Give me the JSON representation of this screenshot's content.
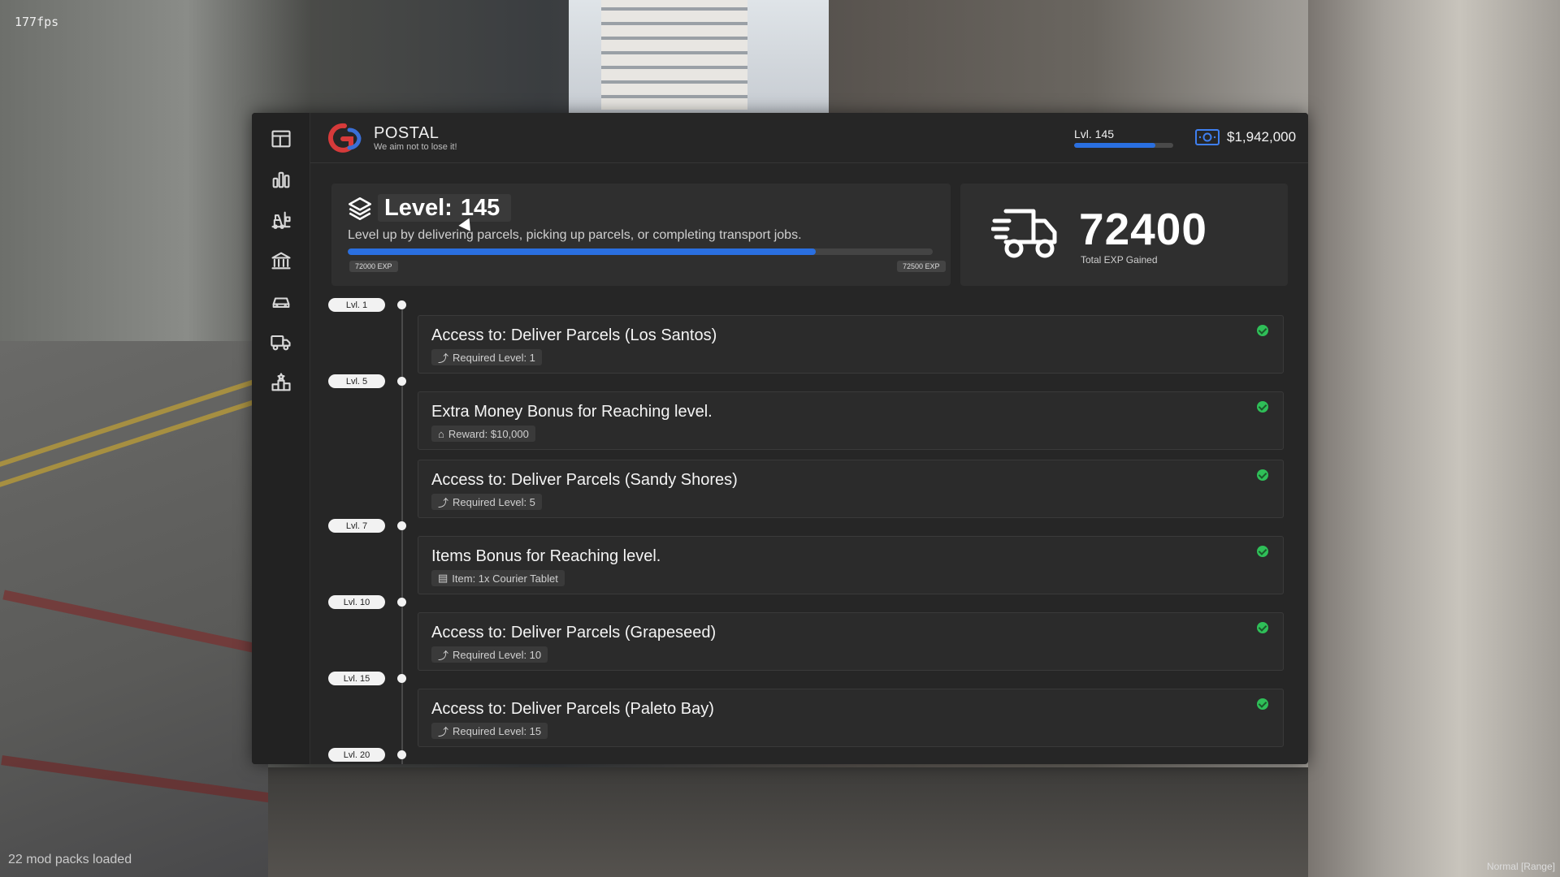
{
  "hud": {
    "fps": "177fps",
    "mods": "22 mod packs loaded",
    "mode": "Normal [Range]"
  },
  "sidebar": {
    "items": [
      {
        "icon": "layout-icon"
      },
      {
        "icon": "bar-chart-icon"
      },
      {
        "icon": "forklift-icon"
      },
      {
        "icon": "bank-icon"
      },
      {
        "icon": "car-icon"
      },
      {
        "icon": "truck-icon"
      },
      {
        "icon": "leaderboard-icon"
      }
    ]
  },
  "header": {
    "title": "POSTAL",
    "subtitle": "We aim not to lose it!",
    "level_label": "Lvl. 145",
    "level_progress": 0.82,
    "money": "$1,942,000"
  },
  "level_card": {
    "label": "Level:",
    "value": "145",
    "description": "Level up by delivering parcels, picking up parcels, or completing transport jobs.",
    "xp_min": "72000 EXP",
    "xp_max": "72500 EXP",
    "xp_progress": 0.8
  },
  "exp_card": {
    "value": "72400",
    "label": "Total EXP Gained"
  },
  "timeline": {
    "levels": [
      "Lvl. 1",
      "Lvl. 5",
      "Lvl. 7",
      "Lvl. 10",
      "Lvl. 15",
      "Lvl. 20"
    ],
    "items": [
      {
        "title": "Access to: Deliver Parcels (Los Santos)",
        "tag": "Required Level: 1",
        "done": true
      },
      {
        "title": "Extra Money Bonus for Reaching level.",
        "tag": "Reward: $10,000",
        "done": true
      },
      {
        "title": "Access to: Deliver Parcels (Sandy Shores)",
        "tag": "Required Level: 5",
        "done": true
      },
      {
        "title": "Items Bonus for Reaching level.",
        "tag": "Item: 1x Courier Tablet",
        "done": true
      },
      {
        "title": "Access to: Deliver Parcels (Grapeseed)",
        "tag": "Required Level: 10",
        "done": true
      },
      {
        "title": "Access to: Deliver Parcels (Paleto Bay)",
        "tag": "Required Level: 15",
        "done": true
      }
    ]
  },
  "colors": {
    "accent": "#2a6fe0",
    "done": "#2fbf58",
    "panel": "#262626"
  }
}
